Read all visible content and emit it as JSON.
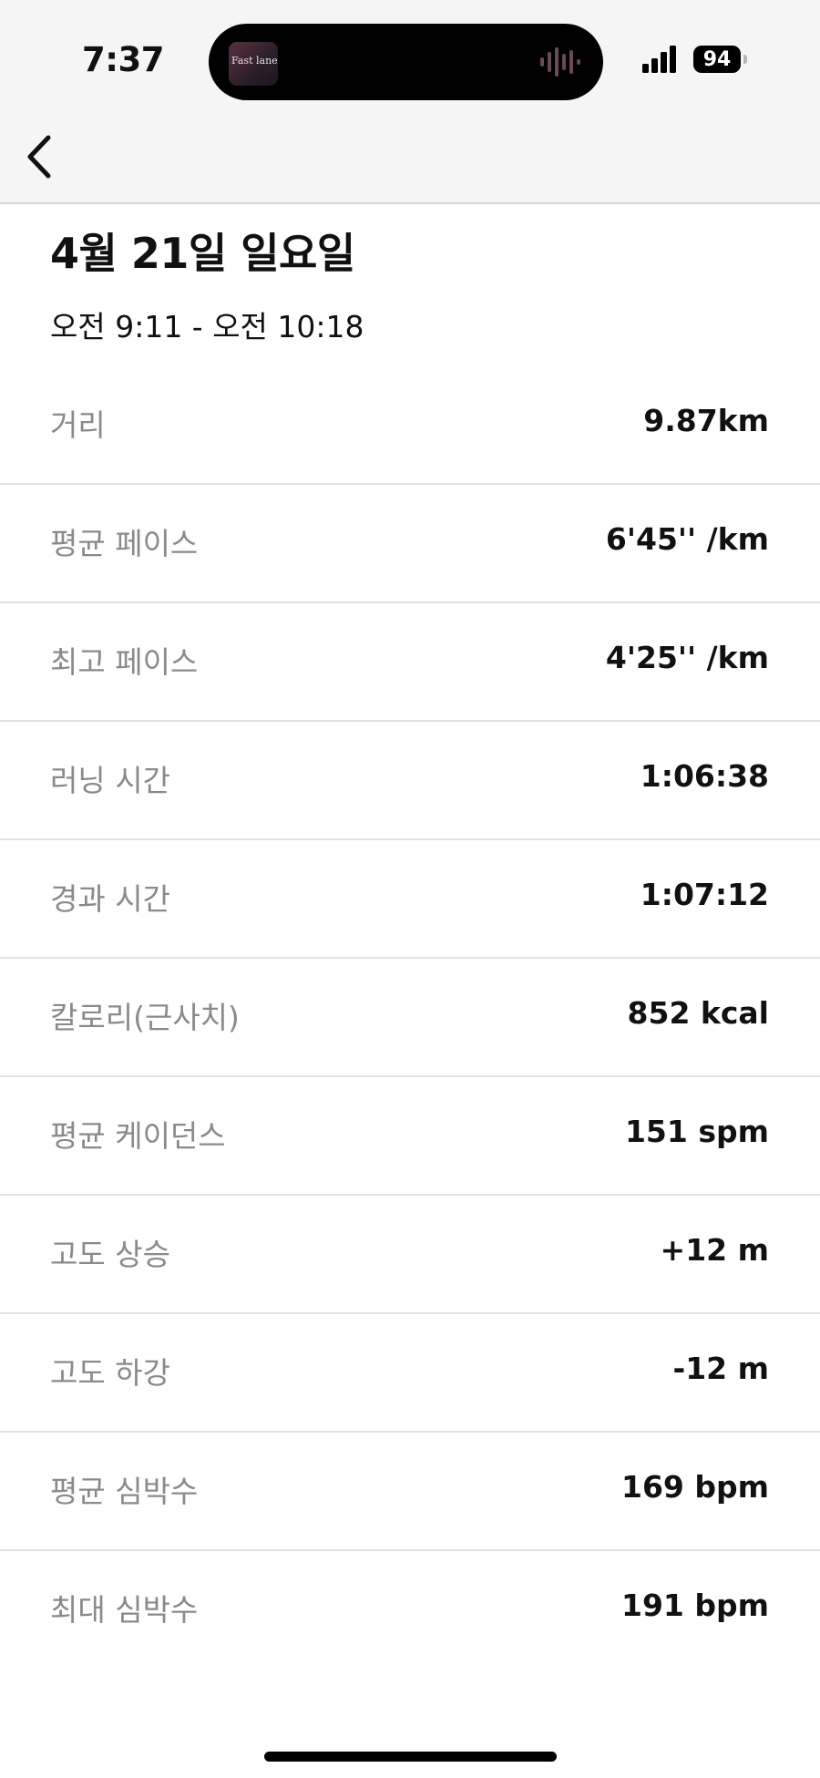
{
  "status_bar": {
    "time": "7:37",
    "battery": "94"
  },
  "now_playing": {
    "album_text": "Fast lanes"
  },
  "header": {
    "title": "4월 21일 일요일",
    "time_range": "오전 9:11 - 오전 10:18"
  },
  "stats": [
    {
      "label": "거리",
      "value": "9.87km"
    },
    {
      "label": "평균 페이스",
      "value": "6'45'' /km"
    },
    {
      "label": "최고 페이스",
      "value": "4'25'' /km"
    },
    {
      "label": "러닝 시간",
      "value": "1:06:38"
    },
    {
      "label": "경과 시간",
      "value": "1:07:12"
    },
    {
      "label": "칼로리(근사치)",
      "value": "852 kcal"
    },
    {
      "label": "평균 케이던스",
      "value": "151 spm"
    },
    {
      "label": "고도 상승",
      "value": "+12 m"
    },
    {
      "label": "고도 하강",
      "value": "-12 m"
    },
    {
      "label": "평균 심박수",
      "value": "169 bpm"
    },
    {
      "label": "최대 심박수",
      "value": "191 bpm"
    }
  ],
  "icons": {
    "back": "chevron-left-icon",
    "signal": "cellular-signal-icon",
    "waveform": "audio-waveform-icon"
  },
  "colors": {
    "label": "#8a8a8a",
    "value": "#111111",
    "topbar": "#f5f5f5"
  }
}
